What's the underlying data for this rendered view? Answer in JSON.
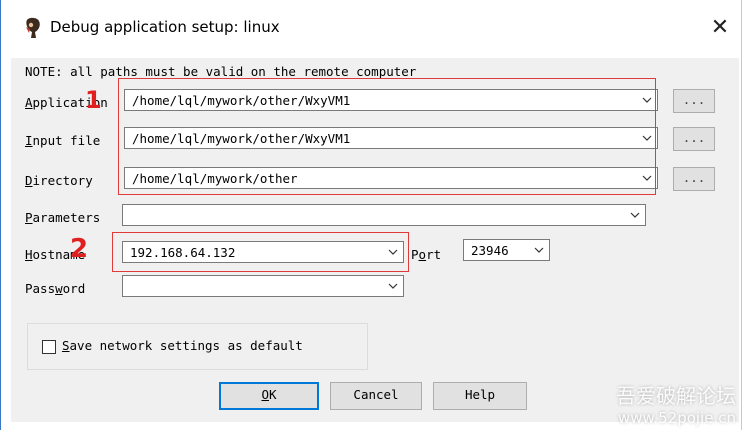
{
  "window": {
    "title": "Debug application setup: linux",
    "close_glyph": "✕"
  },
  "note": "NOTE: all paths must be valid on the remote computer",
  "fields": {
    "application": {
      "label_pre": "",
      "label_key": "A",
      "label_post": "pplication",
      "value": "/home/lql/mywork/other/WxyVM1"
    },
    "input_file": {
      "label_pre": "",
      "label_key": "I",
      "label_post": "nput file",
      "value": "/home/lql/mywork/other/WxyVM1"
    },
    "directory": {
      "label_pre": "",
      "label_key": "D",
      "label_post": "irectory",
      "value": "/home/lql/mywork/other"
    },
    "parameters": {
      "label_pre": "",
      "label_key": "P",
      "label_post": "arameters",
      "value": ""
    },
    "hostname": {
      "label_pre": "",
      "label_key": "H",
      "label_post": "ostname",
      "value": "192.168.64.132"
    },
    "port": {
      "label_pre": "P",
      "label_key": "o",
      "label_post": "rt",
      "value": "23946"
    },
    "password": {
      "label_pre": "Pass",
      "label_key": "w",
      "label_post": "ord",
      "value": ""
    }
  },
  "browse_label": "...",
  "checkbox": {
    "label_key": "S",
    "label_post": "ave network settings as default",
    "checked": false
  },
  "buttons": {
    "ok": {
      "label_key": "O",
      "label_post": "K"
    },
    "cancel": {
      "label": "Cancel"
    },
    "help": {
      "label": "Help"
    }
  },
  "annotations": {
    "mark1": "1",
    "mark2": "2"
  },
  "watermark": {
    "line1": "吾爱破解论坛",
    "line2": "www.52pojie.cn"
  },
  "colors": {
    "annotation_red": "#e03a3a",
    "default_button_border": "#0078d7",
    "dialog_bg": "#f0f0f0"
  }
}
